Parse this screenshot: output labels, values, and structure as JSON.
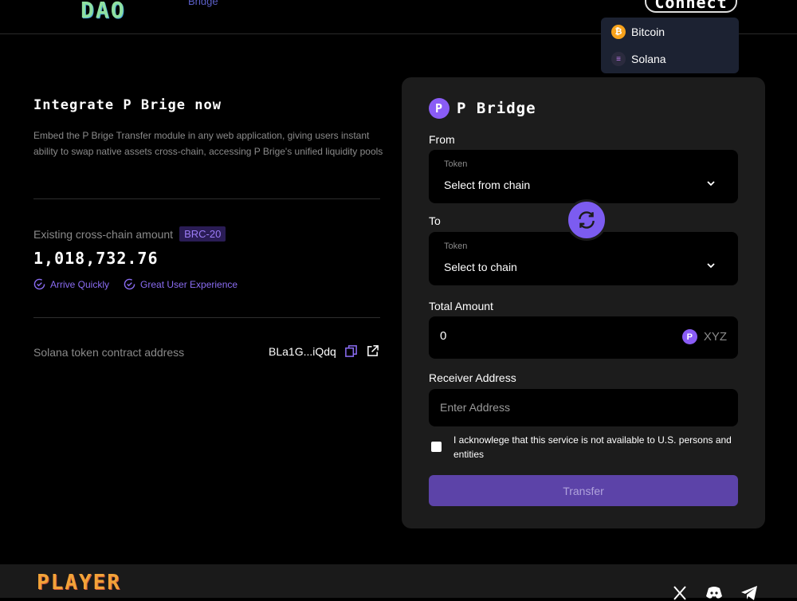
{
  "header": {
    "logo": "DAO",
    "nav_bridge": "Bridge",
    "connect_label": "Connect",
    "chain_menu": [
      {
        "label": "Bitcoin",
        "icon": "bitcoin-icon"
      },
      {
        "label": "Solana",
        "icon": "solana-icon"
      }
    ]
  },
  "intro": {
    "title": "Integrate P Brige now",
    "description": "Embed the P Brige Transfer module in any web application, giving users instant ability to swap native assets cross-chain, accessing P Brige's unified liquidity pools",
    "existing_label": "Existing cross-chain amount",
    "badge": "BRC-20",
    "amount": "1,018,732.76",
    "features": [
      "Arrive Quickly",
      "Great User Experience"
    ],
    "contract_label": "Solana token contract address",
    "contract_address": "BLa1G...iQdq"
  },
  "bridge": {
    "title": "P Bridge",
    "from_label": "From",
    "from_token_label": "Token",
    "from_value": "Select from chain",
    "to_label": "To",
    "to_token_label": "Token",
    "to_value": "Select to chain",
    "amount_label": "Total Amount",
    "amount_value": "0",
    "token_symbol": "XYZ",
    "receiver_label": "Receiver Address",
    "receiver_placeholder": "Enter Address",
    "ack_text": "I acknowlege that this service is not available to U.S. persons and entities",
    "transfer_label": "Transfer"
  },
  "footer": {
    "logo": "PLAYER",
    "socials": [
      "x-icon",
      "discord-icon",
      "telegram-icon"
    ]
  },
  "colors": {
    "accent": "#7c5cf0",
    "background": "#000000",
    "card": "#1c1c1c",
    "footer_logo": "#f2a338"
  }
}
